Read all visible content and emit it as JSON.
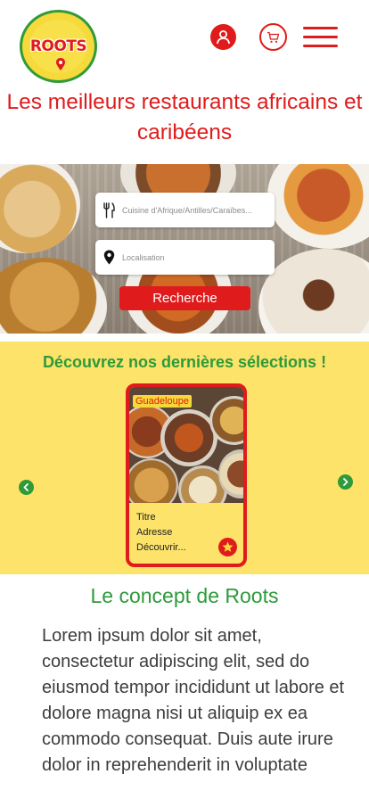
{
  "brand": {
    "logo_text": "ROOTS",
    "primary_color": "#e01b1b",
    "green": "#2e9a3a",
    "yellow": "#fde36a"
  },
  "header": {
    "user_icon": "user-icon",
    "cart_icon": "cart-icon",
    "menu_icon": "hamburger-menu-icon"
  },
  "headline": "Les meilleurs restaurants africains et caribéens",
  "search": {
    "cuisine_placeholder": "Cuisine d'Afrique/Antilles/Caraïbes...",
    "location_placeholder": "Localisation",
    "button_label": "Recherche"
  },
  "selection": {
    "title": "Découvrez nos dernières sélections !",
    "card": {
      "tag": "Guadeloupe",
      "title": "Titre",
      "address": "Adresse",
      "discover": "Découvrir..."
    }
  },
  "concept": {
    "title": "Le concept de Roots",
    "text": "Lorem ipsum dolor sit amet, consectetur adipiscing elit, sed do eiusmod tempor incididunt ut labore et dolore magna nisi ut aliquip ex ea commodo consequat. Duis aute irure dolor in reprehenderit in voluptate"
  }
}
